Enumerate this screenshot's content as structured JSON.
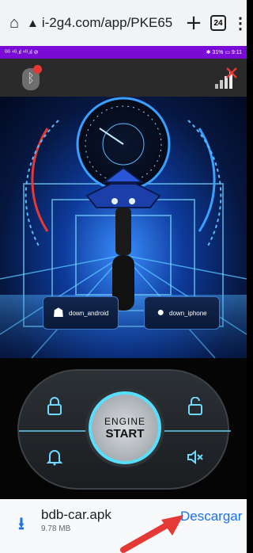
{
  "browser": {
    "url": "i-2g4.com/app/PKE65",
    "tab_count": "24",
    "home_icon": "home-icon",
    "new_tab_icon": "plus-icon",
    "menu_icon": "more-vert-icon"
  },
  "status_bar": {
    "left": "ᴳᴳ ⁴ᴳ.ıl ⁴ᴳ.ıl ⊘",
    "right": "✱ 31% ▭ 9:11"
  },
  "app": {
    "bluetooth_icon": "bluetooth-icon",
    "signal_icon": "signal-off-icon",
    "download_android_label": "down_android",
    "download_iphone_label": "down_iphone",
    "engine_line1": "ENGINE",
    "engine_line2": "START",
    "controls": [
      "lock-icon",
      "unlock-icon",
      "bell-icon",
      "mute-icon"
    ]
  },
  "download": {
    "file_name": "bdb-car.apk",
    "file_size": "9.78 MB",
    "action_label": "Descargar"
  },
  "colors": {
    "accent": "#1a73e8",
    "status_bar": "#7a0bd6",
    "glow": "#6fd9ff",
    "arrow": "#e53935"
  }
}
